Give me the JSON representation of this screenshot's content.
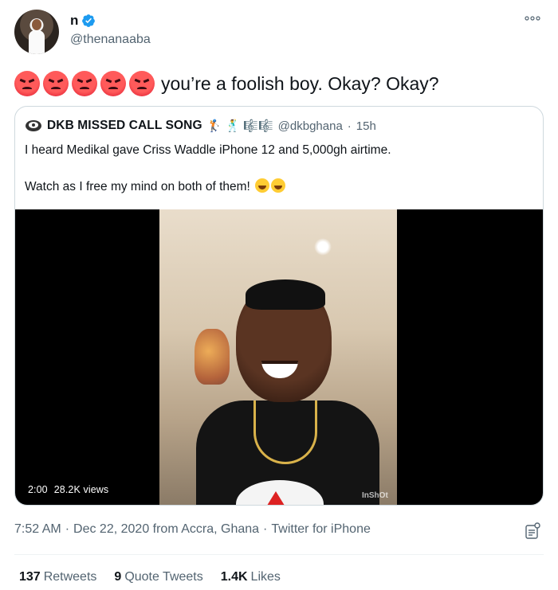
{
  "author": {
    "display_name": "n",
    "handle": "@thenanaaba",
    "verified": true
  },
  "tweet": {
    "emojis": [
      "angry-face",
      "angry-face",
      "angry-face",
      "angry-face",
      "angry-face"
    ],
    "text": "you’re a foolish boy. Okay? Okay?"
  },
  "quoted_tweet": {
    "display_name": "DKB MISSED CALL SONG",
    "name_decorations": "🏌 🕺 🎼🎼",
    "handle": "@dkbghana",
    "separator": "·",
    "time_ago": "15h",
    "line1": "I heard Medikal gave Criss Waddle iPhone 12 and 5,000gh airtime.",
    "line2": "Watch as I free my mind on both of them!",
    "video": {
      "duration": "2:00",
      "views": "28.2K views",
      "watermark": "InShOt"
    }
  },
  "meta": {
    "time": "7:52 AM",
    "sep1": "·",
    "date_location": "Dec 22, 2020 from Accra, Ghana",
    "sep2": "·",
    "source": "Twitter for iPhone"
  },
  "stats": {
    "retweets_count": "137",
    "retweets_label": "Retweets",
    "quotes_count": "9",
    "quotes_label": "Quote Tweets",
    "likes_count": "1.4K",
    "likes_label": "Likes"
  },
  "colors": {
    "verified_blue": "#1d9bf0",
    "secondary_text": "#536471",
    "border": "#cfd9de"
  }
}
